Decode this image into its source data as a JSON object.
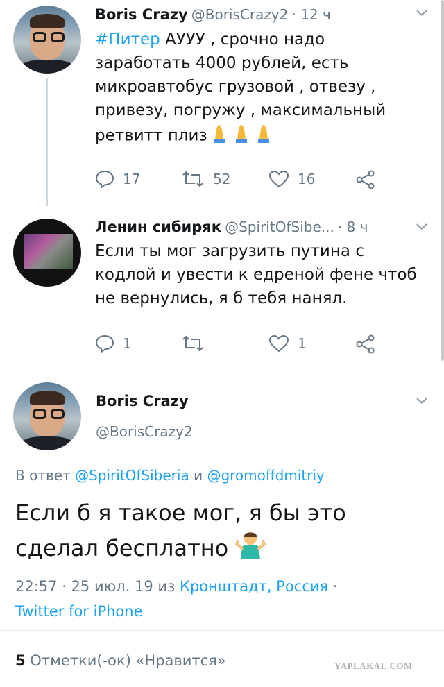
{
  "tweet1": {
    "name": "Boris Crazy",
    "handle": "@BorisCrazy2",
    "time": "· 12 ч",
    "hashtag": "#Питер",
    "lines": [
      " АУУУ , срочно надо",
      "заработать 4000 рублей, есть",
      "микроавтобус грузовой , отвезу ,",
      "привезу, погружу , максимальный",
      "ретвитт плиз"
    ],
    "replies": "17",
    "retweets": "52",
    "likes": "16"
  },
  "tweet2": {
    "name": "Ленин сибиряк",
    "handle": "@SpiritOfSibe...",
    "time": "· 8 ч",
    "lines": [
      "Если ты мог загрузить путина с",
      "кодлой и увести к едреной фене чтоб",
      "не вернулись, я б тебя нанял."
    ],
    "replies": "1",
    "retweets": "",
    "likes": "1"
  },
  "tweet3": {
    "name": "Boris Crazy",
    "handle": "@BorisCrazy2",
    "reply_prefix": "В ответ ",
    "reply_user1": "@SpiritOfSiberia",
    "reply_and": " и ",
    "reply_user2": "@gromoffdmitriy",
    "lines": [
      "Если б я такое мог, я бы это",
      "сделал бесплатно"
    ],
    "meta_time": "22:57 · 25 июл. 19 из ",
    "meta_location": "Кронштадт, Россия",
    "meta_dot": " ·",
    "meta_client": "Twitter for iPhone"
  },
  "footer": {
    "likes_count": "5",
    "likes_label": " Отметки(-ок) «Нравится»",
    "watermark": "YAPLAKAL.COM"
  },
  "colors": {
    "link": "#1da1f2",
    "secondary": "#657786",
    "text": "#14171a",
    "thread_line": "#ccd6dd"
  }
}
